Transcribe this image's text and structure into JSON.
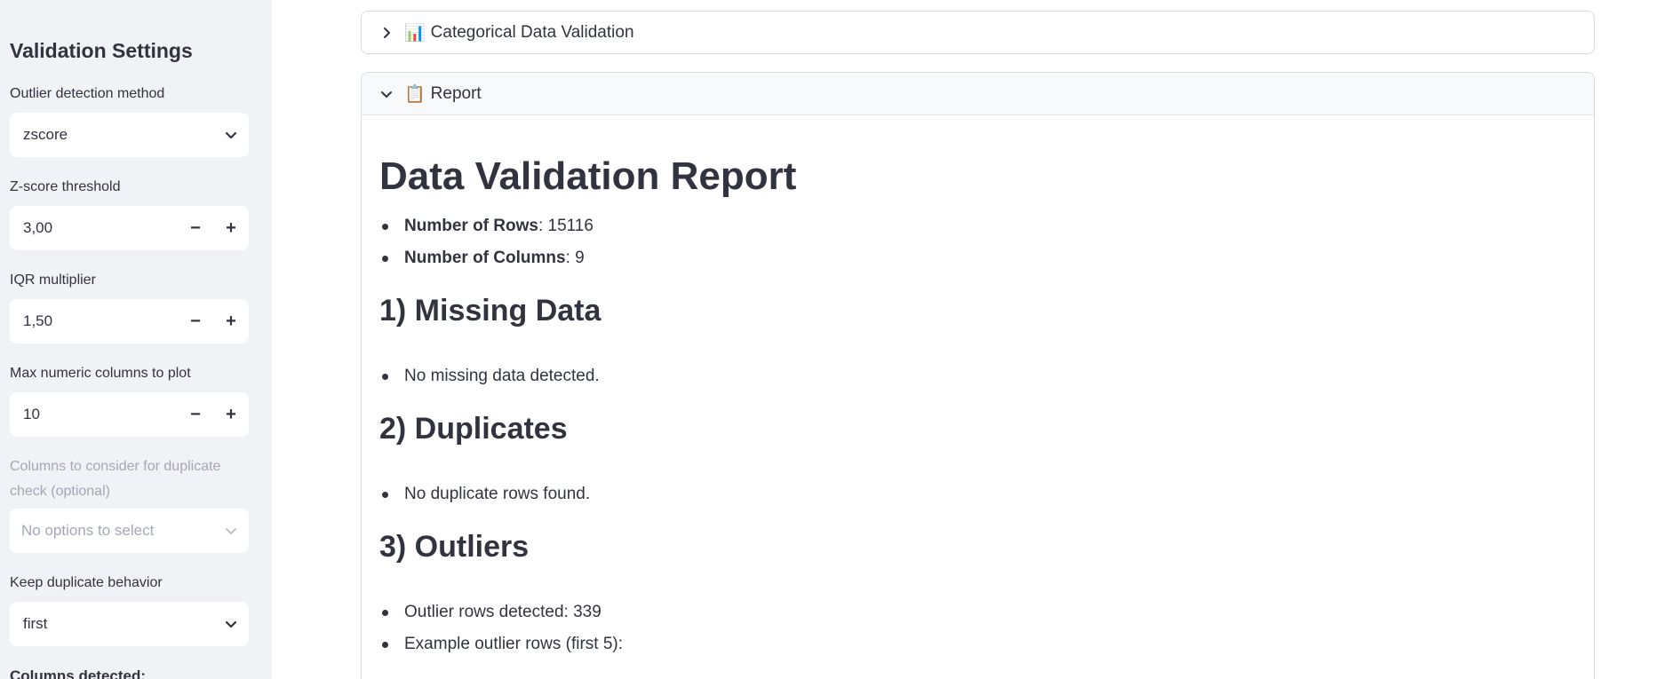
{
  "sidebar": {
    "title": "Validation Settings",
    "outlier_method": {
      "label": "Outlier detection method",
      "value": "zscore"
    },
    "zscore_threshold": {
      "label": "Z-score threshold",
      "value": "3,00",
      "minus": "−",
      "plus": "+"
    },
    "iqr_multiplier": {
      "label": "IQR multiplier",
      "value": "1,50",
      "minus": "−",
      "plus": "+"
    },
    "max_numeric": {
      "label": "Max numeric columns to plot",
      "value": "10",
      "minus": "−",
      "plus": "+"
    },
    "dup_columns": {
      "label": "Columns to consider for duplicate check (optional)",
      "placeholder": "No options to select"
    },
    "keep_dup": {
      "label": "Keep duplicate behavior",
      "value": "first"
    },
    "columns_detected": {
      "label": "Columns detected:"
    }
  },
  "main": {
    "categorical": {
      "emoji": "📊",
      "title": "Categorical Data Validation"
    },
    "report": {
      "emoji": "📋",
      "title": "Report",
      "heading": "Data Validation Report",
      "rows_label": "Number of Rows",
      "rows_value": ": 15116",
      "cols_label": "Number of Columns",
      "cols_value": ": 9",
      "missing_heading": "1) Missing Data",
      "missing_item": "No missing data detected.",
      "dup_heading": "2) Duplicates",
      "dup_item": "No duplicate rows found.",
      "outliers_heading": "3) Outliers",
      "outliers_item1": "Outlier rows detected: 339",
      "outliers_item2": "Example outlier rows (first 5):"
    }
  }
}
